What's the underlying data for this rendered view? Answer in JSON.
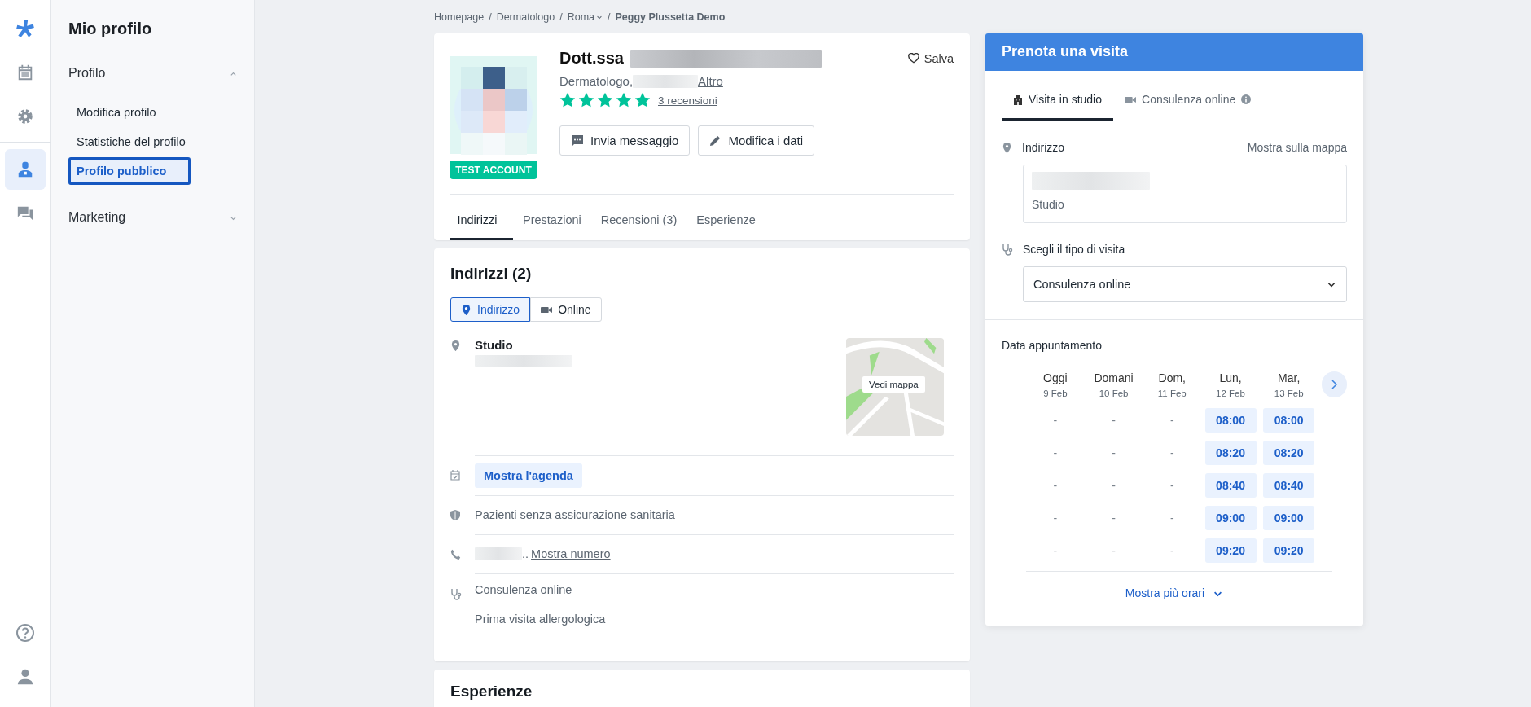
{
  "rail": {
    "items": [
      {
        "kind": "logo",
        "selected": false
      },
      {
        "kind": "calendar",
        "selected": false
      },
      {
        "kind": "settings",
        "selected": false
      },
      {
        "kind": "doctor",
        "selected": true
      },
      {
        "kind": "chat",
        "selected": false
      }
    ],
    "bottom": [
      {
        "kind": "help"
      },
      {
        "kind": "user"
      }
    ]
  },
  "sidebar": {
    "title": "Mio profilo",
    "sections": [
      {
        "label": "Profilo",
        "expanded": true,
        "items": [
          {
            "label": "Modifica profilo",
            "selected": false
          },
          {
            "label": "Statistiche del profilo",
            "selected": false
          },
          {
            "label": "Profilo pubblico",
            "selected": true
          }
        ]
      },
      {
        "label": "Marketing",
        "expanded": false
      }
    ]
  },
  "breadcrumb_separator": "/",
  "breadcrumb": [
    {
      "label": "Homepage",
      "kind": "link"
    },
    {
      "label": "Dermatologo",
      "kind": "link"
    },
    {
      "label": "Roma",
      "kind": "dropdown"
    },
    {
      "label": "Peggy Plussetta Demo",
      "kind": "current"
    }
  ],
  "profile": {
    "title_prefix": "Dott.ssa",
    "specialty": "Dermatologo,",
    "specialty_link": "Altro",
    "stars": 5,
    "reviews_link": "3 recensioni",
    "badge": "TEST ACCOUNT",
    "save": "Salva",
    "buttons": [
      {
        "label": "Invia messaggio",
        "kind": "message"
      },
      {
        "label": "Modifica i dati",
        "kind": "edit"
      }
    ],
    "tabs": [
      {
        "label": "Indirizzi",
        "selected": true
      },
      {
        "label": "Prestazioni",
        "selected": false
      },
      {
        "label": "Recensioni (3)",
        "selected": false
      },
      {
        "label": "Esperienze",
        "selected": false
      }
    ]
  },
  "addresses": {
    "title": "Indirizzi (2)",
    "toggle": [
      {
        "label": "Indirizzo",
        "kind": "pin",
        "selected": true
      },
      {
        "label": "Online",
        "kind": "video",
        "selected": false
      }
    ],
    "place": "Studio",
    "map_button": "Vedi mappa",
    "agenda_button": "Mostra l'agenda",
    "insurance": "Pazienti senza assicurazione sanitaria",
    "phone_suffix": "..",
    "phone_link": "Mostra numero",
    "services": [
      "Consulenza online",
      "Prima visita allergologica"
    ]
  },
  "experiences": {
    "title": "Esperienze"
  },
  "booking": {
    "title": "Prenota una visita",
    "tabs": [
      {
        "label": "Visita in studio",
        "kind": "building",
        "selected": true
      },
      {
        "label": "Consulenza online",
        "kind": "video",
        "selected": false
      }
    ],
    "address_label": "Indirizzo",
    "map_link": "Mostra sulla mappa",
    "address_type": "Studio",
    "visit_type_label": "Scegli il tipo di visita",
    "visit_type_value": "Consulenza online",
    "date_label": "Data appuntamento",
    "days": [
      {
        "day": "Oggi",
        "date": "9 Feb",
        "slots": [
          "-",
          "-",
          "-",
          "-",
          "-"
        ]
      },
      {
        "day": "Domani",
        "date": "10 Feb",
        "slots": [
          "-",
          "-",
          "-",
          "-",
          "-"
        ]
      },
      {
        "day": "Dom,",
        "date": "11 Feb",
        "slots": [
          "-",
          "-",
          "-",
          "-",
          "-"
        ]
      },
      {
        "day": "Lun,",
        "date": "12 Feb",
        "slots": [
          "08:00",
          "08:20",
          "08:40",
          "09:00",
          "09:20"
        ]
      },
      {
        "day": "Mar,",
        "date": "13 Feb",
        "slots": [
          "08:00",
          "08:20",
          "08:40",
          "09:00",
          "09:20"
        ]
      }
    ],
    "more_link": "Mostra più orari"
  }
}
